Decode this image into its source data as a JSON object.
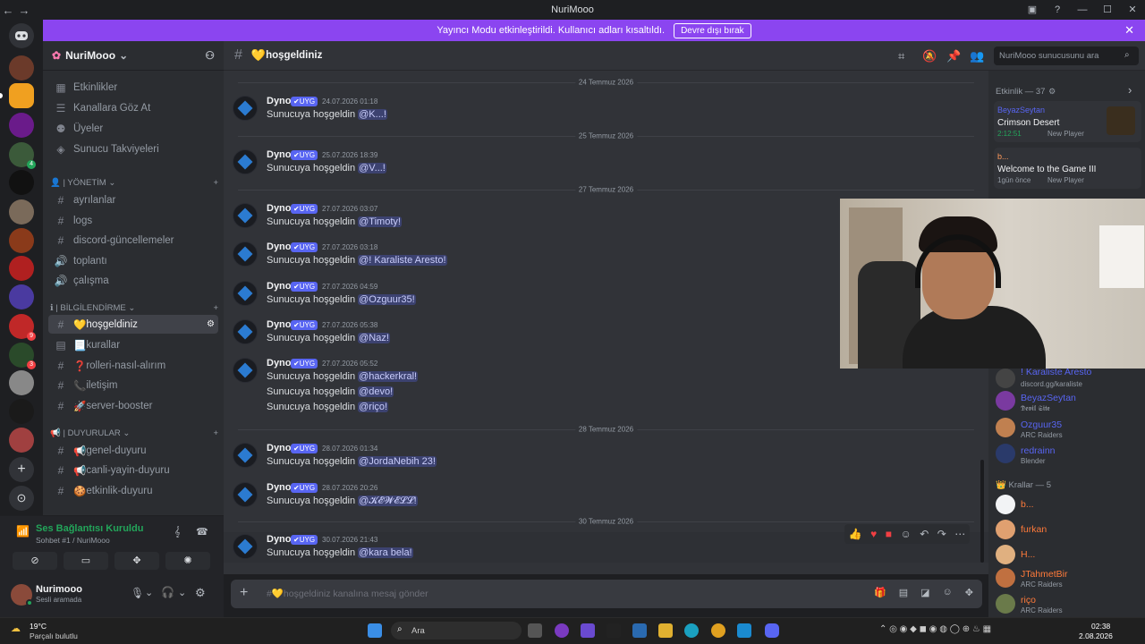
{
  "window": {
    "title": "NuriMooo"
  },
  "streamer_banner": {
    "text": "Yayıncı Modu etkinleştirildi. Kullanıcı adları kısaltıldı.",
    "button": "Devre dışı bırak"
  },
  "server": {
    "name": "NuriMooo"
  },
  "sidebar": {
    "top_items": [
      "Etkinlikler",
      "Kanallara Göz At",
      "Üyeler",
      "Sunucu Takviyeleri"
    ],
    "categories": [
      {
        "label": "| YÖNETİM",
        "channels": [
          "ayrılanlar",
          "logs",
          "discord-güncellemeler",
          "toplantı",
          "çalışma"
        ]
      },
      {
        "label": "| BİLGİLENDİRME",
        "channels": [
          "hoşgeldiniz",
          "kurallar",
          "rolleri-nasıl-alırım",
          "iletişim",
          "server-booster"
        ]
      },
      {
        "label": "| DUYURULAR",
        "channels": [
          "genel-duyuru",
          "canli-yayin-duyuru",
          "etkinlik-duyuru"
        ]
      }
    ]
  },
  "voice": {
    "status": "Ses Bağlantısı Kuruldu",
    "channel": "Sohbet #1 / NuriMooo"
  },
  "user": {
    "name": "Nurimooo",
    "status": "Sesli aramada"
  },
  "channel_header": {
    "name": "hoşgeldiniz"
  },
  "search": {
    "placeholder": "NuriMooo sunucusunu ara"
  },
  "messages": {
    "bot_name": "Dyno",
    "bot_tag": "UYG",
    "welcome_text": "Sunucuya hoşgeldin",
    "dividers": [
      "24 Temmuz 2026",
      "25 Temmuz 2026",
      "27 Temmuz 2026",
      "28 Temmuz 2026",
      "30 Temmuz 2026"
    ],
    "items": [
      {
        "time": "24.07.2026 01:18",
        "mention": "@K...!"
      },
      {
        "time": "25.07.2026 18:39",
        "mention": "@V...!"
      },
      {
        "time": "27.07.2026 03:07",
        "mention": "@Timoty!"
      },
      {
        "time": "27.07.2026 03:18",
        "mention": "@! Karaliste Aresto!"
      },
      {
        "time": "27.07.2026 04:59",
        "mention": "@Ozguur35!"
      },
      {
        "time": "27.07.2026 05:38",
        "mention": "@Naz!"
      },
      {
        "time": "27.07.2026 05:52",
        "mention": "@hackerkral!"
      },
      {
        "time": "",
        "mention": "@devo!"
      },
      {
        "time": "",
        "mention": "@riço!"
      },
      {
        "time": "28.07.2026 01:34",
        "mention": "@JordaNebih 23!"
      },
      {
        "time": "28.07.2026 20:26",
        "mention": "@𝓚𝓔𝓦𝓔𝓛𝓛!"
      },
      {
        "time": "30.07.2026 21:43",
        "mention": "@kara bela!"
      }
    ]
  },
  "composer": {
    "placeholder": "#💛hoşgeldiniz kanalına mesaj gönder"
  },
  "members": {
    "activity_header": "Etkinlik — 37",
    "activities": [
      {
        "user": "BeyazSeytan",
        "title": "Crimson Desert",
        "time": "2:12:51",
        "extra": "New Player"
      },
      {
        "user": "b...",
        "title": "Welcome to the Game III",
        "time": "1gün önce",
        "extra": "New Player"
      }
    ],
    "online": [
      {
        "name": "! Karaliste Aresto",
        "sub": "discord.gg/karaliste"
      },
      {
        "name": "BeyazSeytan",
        "sub": "𝕯𝖊𝖛𝖎𝖑 𝕾𝖎𝖙𝖊"
      },
      {
        "name": "Ozguur35",
        "sub": "ARC Raiders"
      },
      {
        "name": "redrainn",
        "sub": "Blender"
      }
    ],
    "kings_header": "Krallar — 5",
    "kings": [
      {
        "name": "b...",
        "sub": ""
      },
      {
        "name": "furkan",
        "sub": ""
      },
      {
        "name": "H...",
        "sub": ""
      },
      {
        "name": "JTahmetBir",
        "sub": "ARC Raiders"
      },
      {
        "name": "riço",
        "sub": "ARC Raiders"
      }
    ]
  },
  "taskbar": {
    "weather_temp": "19°C",
    "weather_desc": "Parçalı bulutlu",
    "search": "Ara",
    "time": "02:38",
    "date": "2.08.2026"
  },
  "colors": {
    "accent": "#5865f2",
    "banner": "#8b45f0",
    "mention_bg": "#3c4270",
    "online": "#23a55a"
  }
}
